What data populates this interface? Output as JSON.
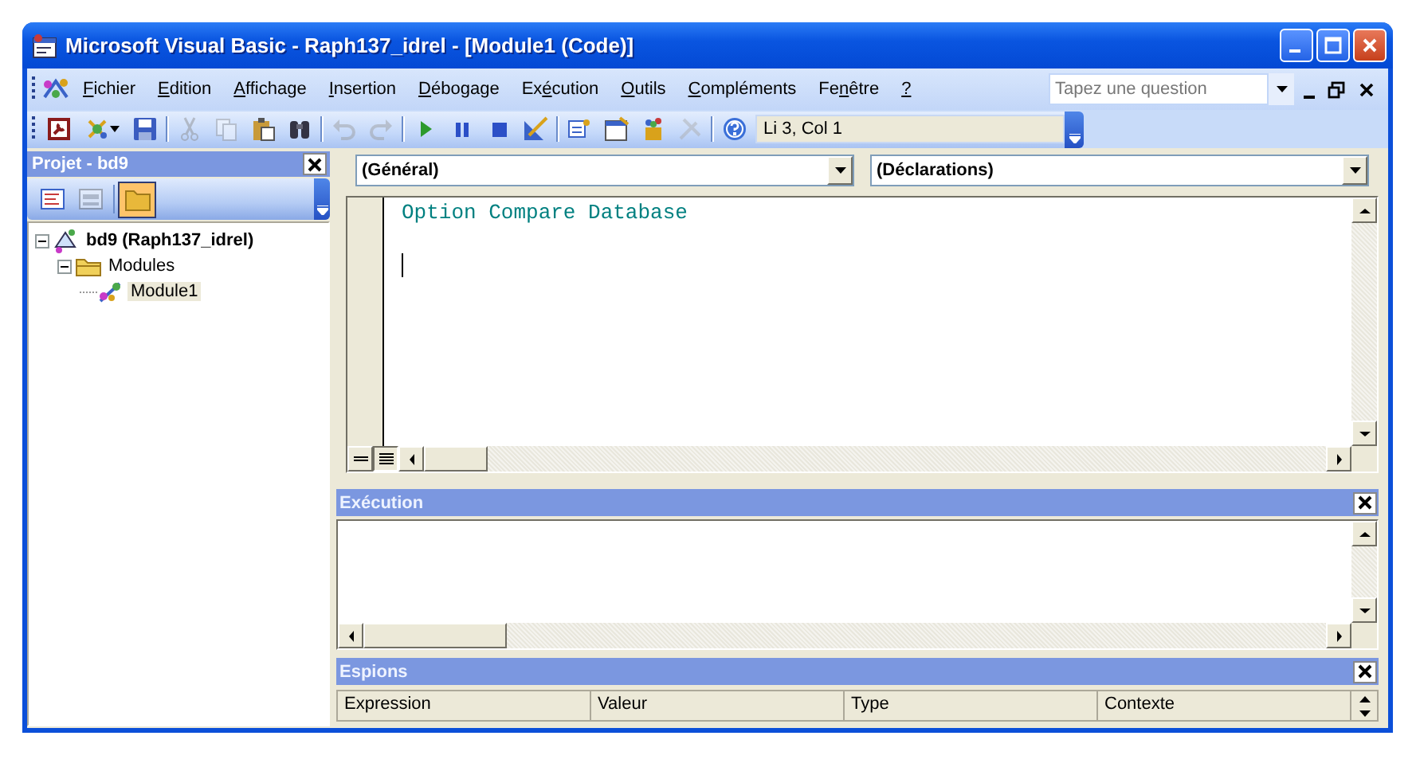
{
  "window": {
    "title": "Microsoft Visual Basic - Raph137_idrel - [Module1 (Code)]"
  },
  "menu": [
    {
      "key": "F",
      "after": "ichier"
    },
    {
      "key": "E",
      "after": "dition"
    },
    {
      "key": "A",
      "after": "ffichage"
    },
    {
      "key": "I",
      "after": "nsertion"
    },
    {
      "key": "D",
      "after": "ébogage"
    },
    {
      "before": "Ex",
      "key": "é",
      "after": "cution"
    },
    {
      "key": "O",
      "after": "utils"
    },
    {
      "key": "C",
      "after": "ompléments"
    },
    {
      "before": "Fe",
      "key": "n",
      "after": "être"
    },
    {
      "key": "?"
    }
  ],
  "help_search": {
    "placeholder": "Tapez une question"
  },
  "toolbar": [
    {
      "kind": "access",
      "disabled": false
    },
    {
      "kind": "insert",
      "disabled": false
    },
    {
      "kind": "save",
      "disabled": false
    },
    {
      "kind": "separator"
    },
    {
      "kind": "cut",
      "disabled": true
    },
    {
      "kind": "copy",
      "disabled": true
    },
    {
      "kind": "paste",
      "disabled": false
    },
    {
      "kind": "find",
      "disabled": false
    },
    {
      "kind": "separator"
    },
    {
      "kind": "undo",
      "disabled": true
    },
    {
      "kind": "redo",
      "disabled": true
    },
    {
      "kind": "separator"
    },
    {
      "kind": "run",
      "disabled": false
    },
    {
      "kind": "pause",
      "disabled": false
    },
    {
      "kind": "stop",
      "disabled": false
    },
    {
      "kind": "design",
      "disabled": false
    },
    {
      "kind": "separator"
    },
    {
      "kind": "project",
      "disabled": false
    },
    {
      "kind": "properties",
      "disabled": false
    },
    {
      "kind": "objects",
      "disabled": false
    },
    {
      "kind": "tools",
      "disabled": true
    },
    {
      "kind": "separator"
    },
    {
      "kind": "help",
      "disabled": false
    }
  ],
  "position": "Li 3, Col 1",
  "project": {
    "title": "Projet - bd9",
    "views": [
      {
        "kind": "code",
        "disabled": false,
        "selected": false
      },
      {
        "kind": "form",
        "disabled": true,
        "selected": false
      },
      {
        "kind": "folders",
        "disabled": false,
        "selected": true
      }
    ],
    "tree": [
      {
        "label": "bd9 (Raph137_idrel)",
        "kind": "project",
        "expanded": true,
        "selected": false,
        "children": [
          {
            "label": "Modules",
            "kind": "folder",
            "expanded": true,
            "selected": false,
            "children": [
              {
                "label": "Module1",
                "kind": "module",
                "selected": true
              }
            ]
          }
        ]
      }
    ]
  },
  "code": {
    "object": "(Général)",
    "procedure": "(Déclarations)",
    "lines": [
      {
        "text": "Option Compare Database",
        "caret": false
      },
      {
        "caret": false
      },
      {
        "caret": true
      }
    ]
  },
  "immediate": {
    "title": "Exécution"
  },
  "watches": {
    "title": "Espions",
    "columns": [
      "Expression",
      "Valeur",
      "Type",
      "Contexte"
    ]
  }
}
